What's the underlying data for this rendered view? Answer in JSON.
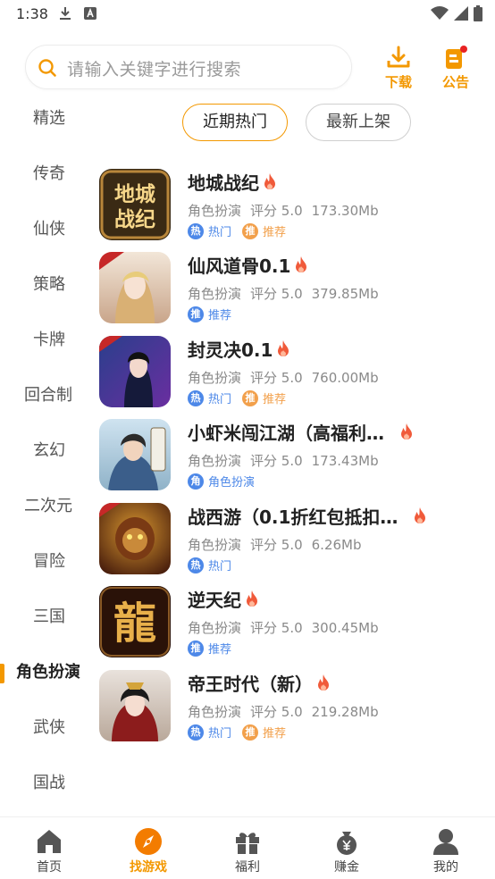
{
  "status_bar": {
    "time": "1:38",
    "download_icon": "download-icon",
    "a_icon": "a-badge-icon"
  },
  "search": {
    "placeholder": "请输入关键字进行搜索"
  },
  "header": {
    "download_label": "下载",
    "announcement_label": "公告"
  },
  "sidebar": {
    "items": [
      "精选",
      "传奇",
      "仙侠",
      "策略",
      "卡牌",
      "回合制",
      "玄幻",
      "二次元",
      "冒险",
      "三国",
      "角色扮演",
      "武侠",
      "国战"
    ],
    "active_index": 10
  },
  "subtabs": {
    "active": "近期热门",
    "inactive": "最新上架"
  },
  "games": [
    {
      "name": "地城战纪",
      "category": "角色扮演",
      "rating": "评分 5.0",
      "size": "173.30Mb",
      "tags": [
        {
          "badge": "热",
          "text": "热门",
          "color": "blue"
        },
        {
          "badge": "推",
          "text": "推荐",
          "color": "orange"
        }
      ]
    },
    {
      "name": "仙风道骨0.1",
      "category": "角色扮演",
      "rating": "评分 5.0",
      "size": "379.85Mb",
      "tags": [
        {
          "badge": "推",
          "text": "推荐",
          "color": "blue"
        }
      ]
    },
    {
      "name": "封灵决0.1",
      "category": "角色扮演",
      "rating": "评分 5.0",
      "size": "760.00Mb",
      "tags": [
        {
          "badge": "热",
          "text": "热门",
          "color": "blue"
        },
        {
          "badge": "推",
          "text": "推荐",
          "color": "orange"
        }
      ]
    },
    {
      "name": "小虾米闯江湖（高福利…",
      "category": "角色扮演",
      "rating": "评分 5.0",
      "size": "173.43Mb",
      "tags": [
        {
          "badge": "角",
          "text": "角色扮演",
          "color": "blue"
        }
      ]
    },
    {
      "name": "战西游（0.1折红包抵扣…",
      "category": "角色扮演",
      "rating": "评分 5.0",
      "size": "6.26Mb",
      "tags": [
        {
          "badge": "热",
          "text": "热门",
          "color": "blue"
        }
      ]
    },
    {
      "name": "逆天纪",
      "category": "角色扮演",
      "rating": "评分 5.0",
      "size": "300.45Mb",
      "tags": [
        {
          "badge": "推",
          "text": "推荐",
          "color": "blue"
        }
      ]
    },
    {
      "name": "帝王时代（新）",
      "category": "角色扮演",
      "rating": "评分 5.0",
      "size": "219.28Mb",
      "tags": [
        {
          "badge": "热",
          "text": "热门",
          "color": "blue"
        },
        {
          "badge": "推",
          "text": "推荐",
          "color": "orange"
        }
      ]
    }
  ],
  "icon_text": {
    "game_1": "地城战纪",
    "game_3_corner": "0.1折",
    "game_4": "闯江湖",
    "game_6": "龍"
  },
  "bottom_nav": [
    {
      "label": "首页",
      "icon": "home-icon"
    },
    {
      "label": "找游戏",
      "icon": "compass-icon",
      "active": true
    },
    {
      "label": "福利",
      "icon": "gift-icon"
    },
    {
      "label": "赚金",
      "icon": "money-bag-icon"
    },
    {
      "label": "我的",
      "icon": "user-icon"
    }
  ],
  "colors": {
    "accent": "#f39800",
    "tag_blue": "#4d88e8",
    "tag_orange": "#f2a04b",
    "flame": "#f05a3a"
  }
}
